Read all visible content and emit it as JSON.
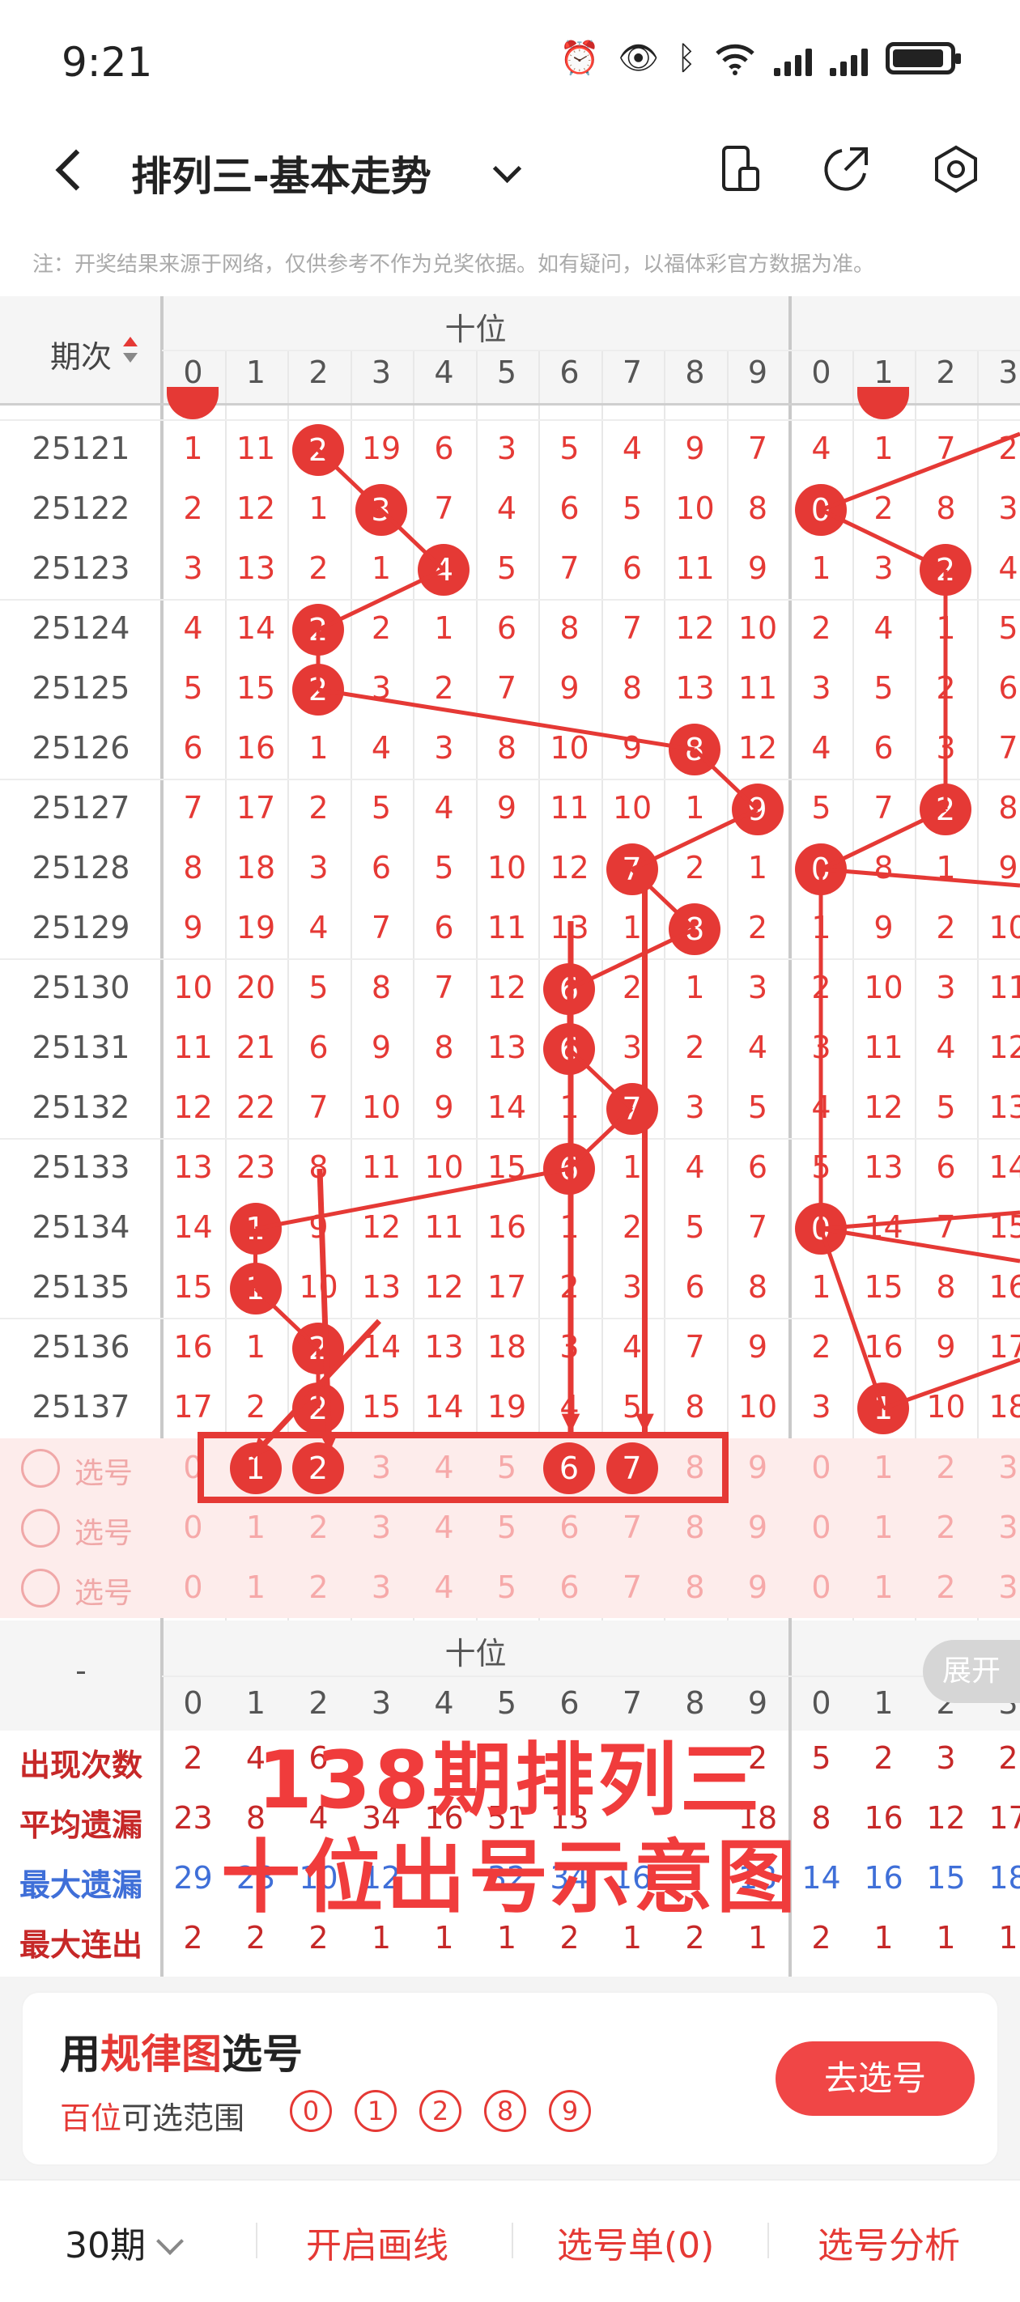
{
  "status": {
    "time": "9:21"
  },
  "nav": {
    "title": "排列三-基本走势"
  },
  "notice": "注：开奖结果来源于网络，仅供参考不作为兑奖依据。如有疑问，以福体彩官方数据为准。",
  "table": {
    "period_header": "期次",
    "group_header": "十位",
    "digits": [
      "0",
      "1",
      "2",
      "3",
      "4",
      "5",
      "6",
      "7",
      "8",
      "9"
    ],
    "digits2": [
      "0",
      "1",
      "2",
      "3"
    ],
    "rows": [
      {
        "period": "25121",
        "tens": [
          "1",
          "11",
          "2",
          "19",
          "6",
          "3",
          "5",
          "4",
          "9",
          "7"
        ],
        "hit": 2,
        "next": [
          "4",
          "1",
          "7",
          "2"
        ],
        "nhit": -1
      },
      {
        "period": "25122",
        "tens": [
          "2",
          "12",
          "1",
          "3",
          "7",
          "4",
          "6",
          "5",
          "10",
          "8"
        ],
        "hit": 3,
        "next": [
          "0",
          "2",
          "8",
          "3"
        ],
        "nhit": 0
      },
      {
        "period": "25123",
        "tens": [
          "3",
          "13",
          "2",
          "1",
          "4",
          "5",
          "7",
          "6",
          "11",
          "9"
        ],
        "hit": 4,
        "next": [
          "1",
          "3",
          "2",
          "4"
        ],
        "nhit": 2
      },
      {
        "period": "25124",
        "tens": [
          "4",
          "14",
          "2",
          "2",
          "1",
          "6",
          "8",
          "7",
          "12",
          "10"
        ],
        "hit": 2,
        "next": [
          "2",
          "4",
          "1",
          "5"
        ],
        "nhit": -1
      },
      {
        "period": "25125",
        "tens": [
          "5",
          "15",
          "2",
          "3",
          "2",
          "7",
          "9",
          "8",
          "13",
          "11"
        ],
        "hit": 2,
        "next": [
          "3",
          "5",
          "2",
          "6"
        ],
        "nhit": -1
      },
      {
        "period": "25126",
        "tens": [
          "6",
          "16",
          "1",
          "4",
          "3",
          "8",
          "10",
          "9",
          "8",
          "12"
        ],
        "hit": 8,
        "next": [
          "4",
          "6",
          "3",
          "7"
        ],
        "nhit": -1
      },
      {
        "period": "25127",
        "tens": [
          "7",
          "17",
          "2",
          "5",
          "4",
          "9",
          "11",
          "10",
          "1",
          "9"
        ],
        "hit": 9,
        "next": [
          "5",
          "7",
          "2",
          "8"
        ],
        "nhit": 2
      },
      {
        "period": "25128",
        "tens": [
          "8",
          "18",
          "3",
          "6",
          "5",
          "10",
          "12",
          "7",
          "2",
          "1"
        ],
        "hit": 7,
        "next": [
          "0",
          "8",
          "1",
          "9"
        ],
        "nhit": 0
      },
      {
        "period": "25129",
        "tens": [
          "9",
          "19",
          "4",
          "7",
          "6",
          "11",
          "13",
          "1",
          "8",
          "2"
        ],
        "hit": 8,
        "next": [
          "1",
          "9",
          "2",
          "10"
        ],
        "nhit": -1
      },
      {
        "period": "25130",
        "tens": [
          "10",
          "20",
          "5",
          "8",
          "7",
          "12",
          "6",
          "2",
          "1",
          "3"
        ],
        "hit": 6,
        "next": [
          "2",
          "10",
          "3",
          "11"
        ],
        "nhit": -1
      },
      {
        "period": "25131",
        "tens": [
          "11",
          "21",
          "6",
          "9",
          "8",
          "13",
          "6",
          "3",
          "2",
          "4"
        ],
        "hit": 6,
        "next": [
          "3",
          "11",
          "4",
          "12"
        ],
        "nhit": -1
      },
      {
        "period": "25132",
        "tens": [
          "12",
          "22",
          "7",
          "10",
          "9",
          "14",
          "1",
          "7",
          "3",
          "5"
        ],
        "hit": 7,
        "next": [
          "4",
          "12",
          "5",
          "13"
        ],
        "nhit": -1
      },
      {
        "period": "25133",
        "tens": [
          "13",
          "23",
          "8",
          "11",
          "10",
          "15",
          "6",
          "1",
          "4",
          "6"
        ],
        "hit": 6,
        "next": [
          "5",
          "13",
          "6",
          "14"
        ],
        "nhit": -1
      },
      {
        "period": "25134",
        "tens": [
          "14",
          "1",
          "9",
          "12",
          "11",
          "16",
          "1",
          "2",
          "5",
          "7"
        ],
        "hit": 1,
        "next": [
          "0",
          "14",
          "7",
          "15"
        ],
        "nhit": 0
      },
      {
        "period": "25135",
        "tens": [
          "15",
          "1",
          "10",
          "13",
          "12",
          "17",
          "2",
          "3",
          "6",
          "8"
        ],
        "hit": 1,
        "next": [
          "1",
          "15",
          "8",
          "16"
        ],
        "nhit": -1
      },
      {
        "period": "25136",
        "tens": [
          "16",
          "1",
          "2",
          "14",
          "13",
          "18",
          "3",
          "4",
          "7",
          "9"
        ],
        "hit": 2,
        "next": [
          "2",
          "16",
          "9",
          "17"
        ],
        "nhit": -1
      },
      {
        "period": "25137",
        "tens": [
          "17",
          "2",
          "2",
          "15",
          "14",
          "19",
          "4",
          "5",
          "8",
          "10"
        ],
        "hit": 2,
        "next": [
          "3",
          "1",
          "10",
          "18"
        ],
        "nhit": 1
      }
    ],
    "select_label": "选号",
    "selected": [
      1,
      2,
      6,
      7
    ]
  },
  "stats": {
    "expand_label": "展开",
    "dash": "-",
    "rows": [
      {
        "label": "出现次数",
        "color": "#c62828",
        "values": [
          "2",
          "4",
          "6",
          "",
          "",
          "",
          "",
          "",
          "",
          "2"
        ],
        "next": [
          "5",
          "2",
          "3",
          "2"
        ]
      },
      {
        "label": "平均遗漏",
        "color": "#c62828",
        "values": [
          "23",
          "8",
          "4",
          "34",
          "16",
          "51",
          "13",
          "",
          "",
          "18"
        ],
        "next": [
          "8",
          "16",
          "12",
          "17"
        ]
      },
      {
        "label": "最大遗漏",
        "color": "#3f6fd8",
        "values": [
          "29",
          "23",
          "10",
          "12",
          "",
          "32",
          "34",
          "16",
          "",
          "13"
        ],
        "next": [
          "14",
          "16",
          "15",
          "18"
        ]
      },
      {
        "label": "最大连出",
        "color": "#c62828",
        "values": [
          "2",
          "2",
          "2",
          "1",
          "1",
          "1",
          "2",
          "1",
          "2",
          "1"
        ],
        "next": [
          "2",
          "1",
          "1",
          "1"
        ]
      }
    ]
  },
  "annotation": {
    "line1": "138期排列三",
    "line2": "十位出号示意图"
  },
  "promo": {
    "title_prefix": "用",
    "title_highlight": "规律图",
    "title_suffix": "选号",
    "range_prefix": "百位",
    "range_suffix": "可选范围",
    "balls": [
      "0",
      "1",
      "2",
      "8",
      "9"
    ],
    "button": "去选号"
  },
  "bottom": {
    "periods": "30期",
    "draw_line": "开启画线",
    "selection": "选号单(0)",
    "analysis": "选号分析"
  },
  "colors": {
    "accent": "#e53935",
    "button": "#f04646",
    "bg_select": "#fdeceb"
  }
}
